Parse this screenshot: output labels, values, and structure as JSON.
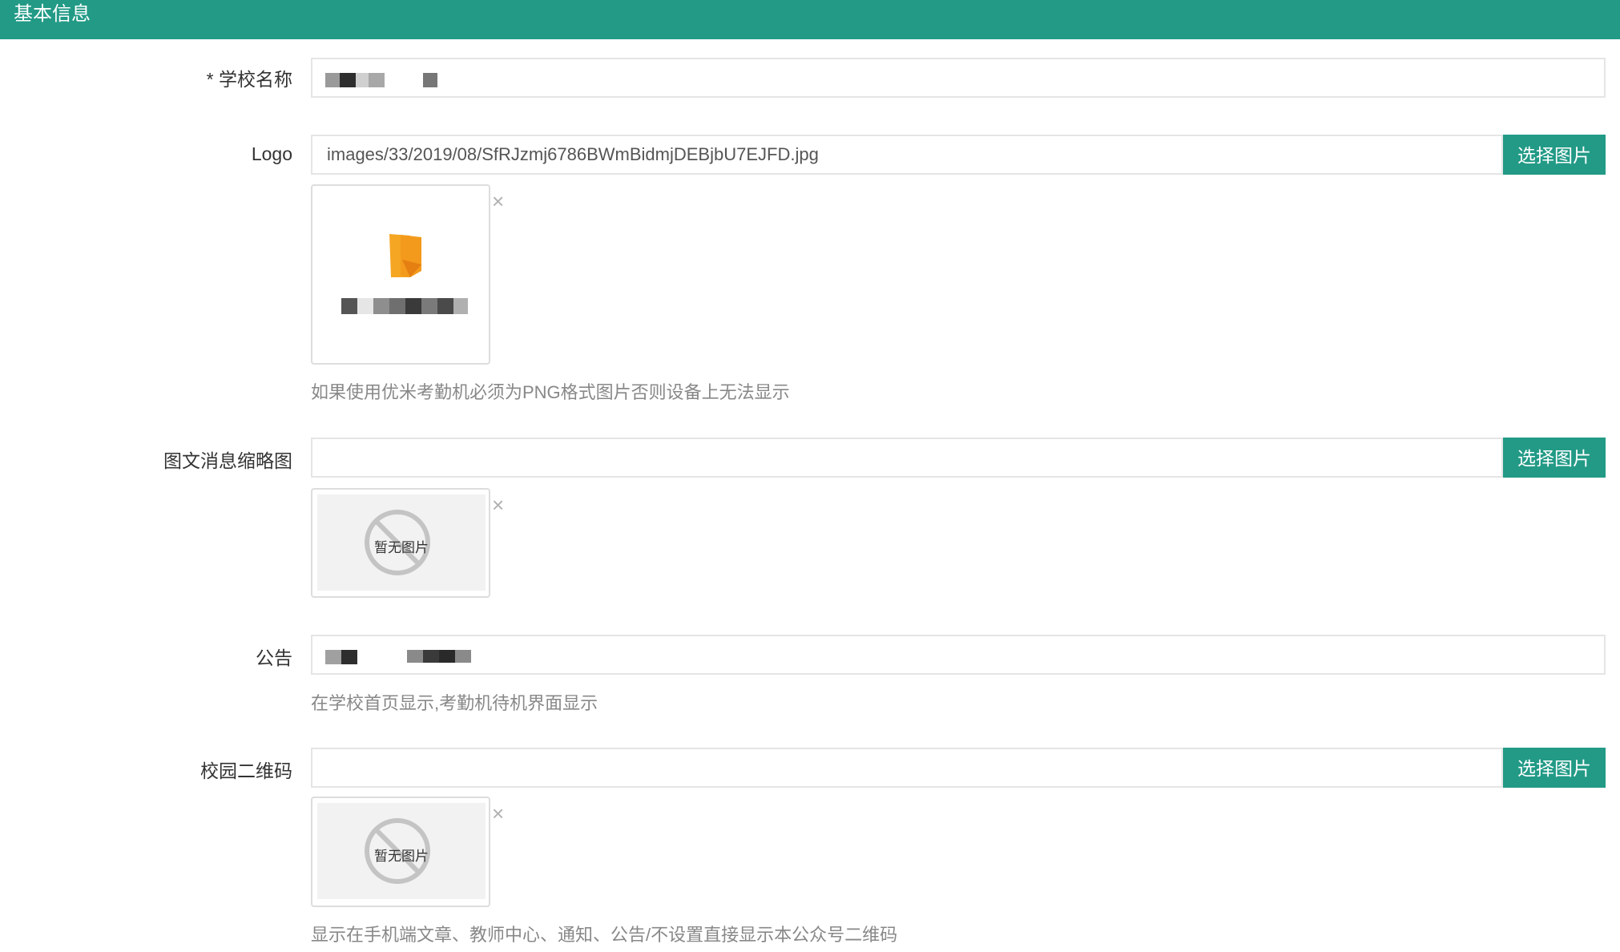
{
  "header": {
    "title": "基本信息"
  },
  "fields": {
    "school_name": {
      "label": "* 学校名称"
    },
    "logo": {
      "label": "Logo",
      "value": "images/33/2019/08/SfRJzmj6786BWmBidmjDEBjbU7EJFD.jpg",
      "button": "选择图片",
      "remove": "×",
      "hint": "如果使用优米考勤机必须为PNG格式图片否则设备上无法显示"
    },
    "news_thumbnail": {
      "label": "图文消息缩略图",
      "value": "",
      "button": "选择图片",
      "remove": "×",
      "placeholder_text": "暂无图片"
    },
    "notice": {
      "label": "公告",
      "hint": "在学校首页显示,考勤机待机界面显示"
    },
    "campus_qrcode": {
      "label": "校园二维码",
      "value": "",
      "button": "选择图片",
      "remove": "×",
      "placeholder_text": "暂无图片",
      "hint": "显示在手机端文章、教师中心、通知、公告/不设置直接显示本公众号二维码"
    }
  },
  "colors": {
    "accent": "#229a86",
    "border": "#e5e5e5",
    "hint": "#888888"
  }
}
